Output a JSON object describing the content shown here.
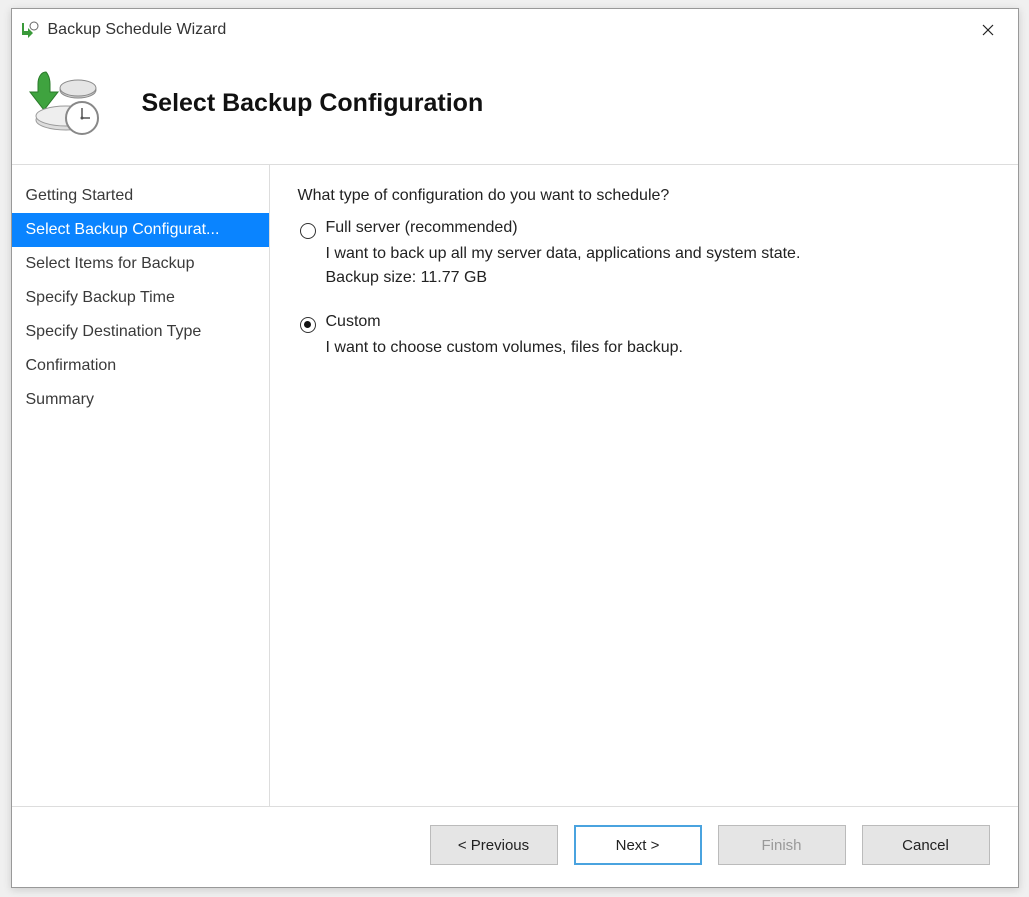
{
  "window": {
    "title": "Backup Schedule Wizard"
  },
  "header": {
    "title": "Select Backup Configuration"
  },
  "sidebar": {
    "steps": [
      "Getting Started",
      "Select Backup Configurat...",
      "Select Items for Backup",
      "Specify Backup Time",
      "Specify Destination Type",
      "Confirmation",
      "Summary"
    ],
    "active_index": 1
  },
  "content": {
    "prompt": "What type of configuration do you want to schedule?",
    "options": [
      {
        "label": "Full server (recommended)",
        "desc1": "I want to back up all my server data, applications and system state.",
        "desc2": "Backup size: 11.77 GB",
        "selected": false
      },
      {
        "label": "Custom",
        "desc1": "I want to choose custom volumes, files for backup.",
        "desc2": "",
        "selected": true
      }
    ]
  },
  "buttons": {
    "previous": "< Previous",
    "next": "Next >",
    "finish": "Finish",
    "cancel": "Cancel"
  }
}
